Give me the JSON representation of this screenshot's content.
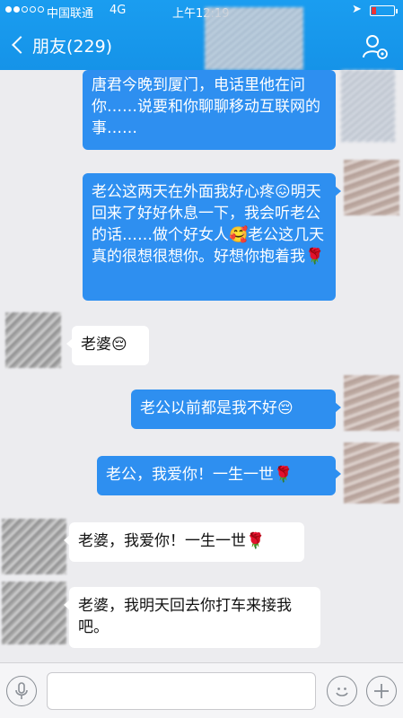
{
  "status_bar": {
    "carrier": "中国联通",
    "network": "4G",
    "time": "上午12:19"
  },
  "header": {
    "back_label": "朋友(229)",
    "profile_icon": "profile-settings-icon"
  },
  "messages": [
    {
      "side": "out",
      "text": "唐君今晚到厦门，电话里他在问你……说要和你聊聊移动互联网的事……"
    },
    {
      "side": "out",
      "text": "老公这两天在外面我好心疼😖明天回来了好好休息一下，我会听老公的话……做个好女人🥰老公这几天真的很想很想你。好想你抱着我🌹"
    },
    {
      "side": "in",
      "text": "老婆😔"
    },
    {
      "side": "out",
      "text": "老公以前都是我不好😔"
    },
    {
      "side": "out",
      "text": "老公，我爱你！一生一世🌹"
    },
    {
      "side": "in",
      "text": "老婆，我爱你！一生一世🌹"
    },
    {
      "side": "in",
      "text": "老婆，我明天回去你打车来接我吧。"
    }
  ],
  "input": {
    "placeholder": "",
    "voice_icon": "microphone-icon",
    "emoji_icon": "smiley-icon",
    "plus_icon": "plus-icon"
  },
  "colors": {
    "header_blue": "#1593e8",
    "outgoing_bubble": "#2e8ff0",
    "incoming_bubble": "#ffffff",
    "background": "#ececef"
  }
}
